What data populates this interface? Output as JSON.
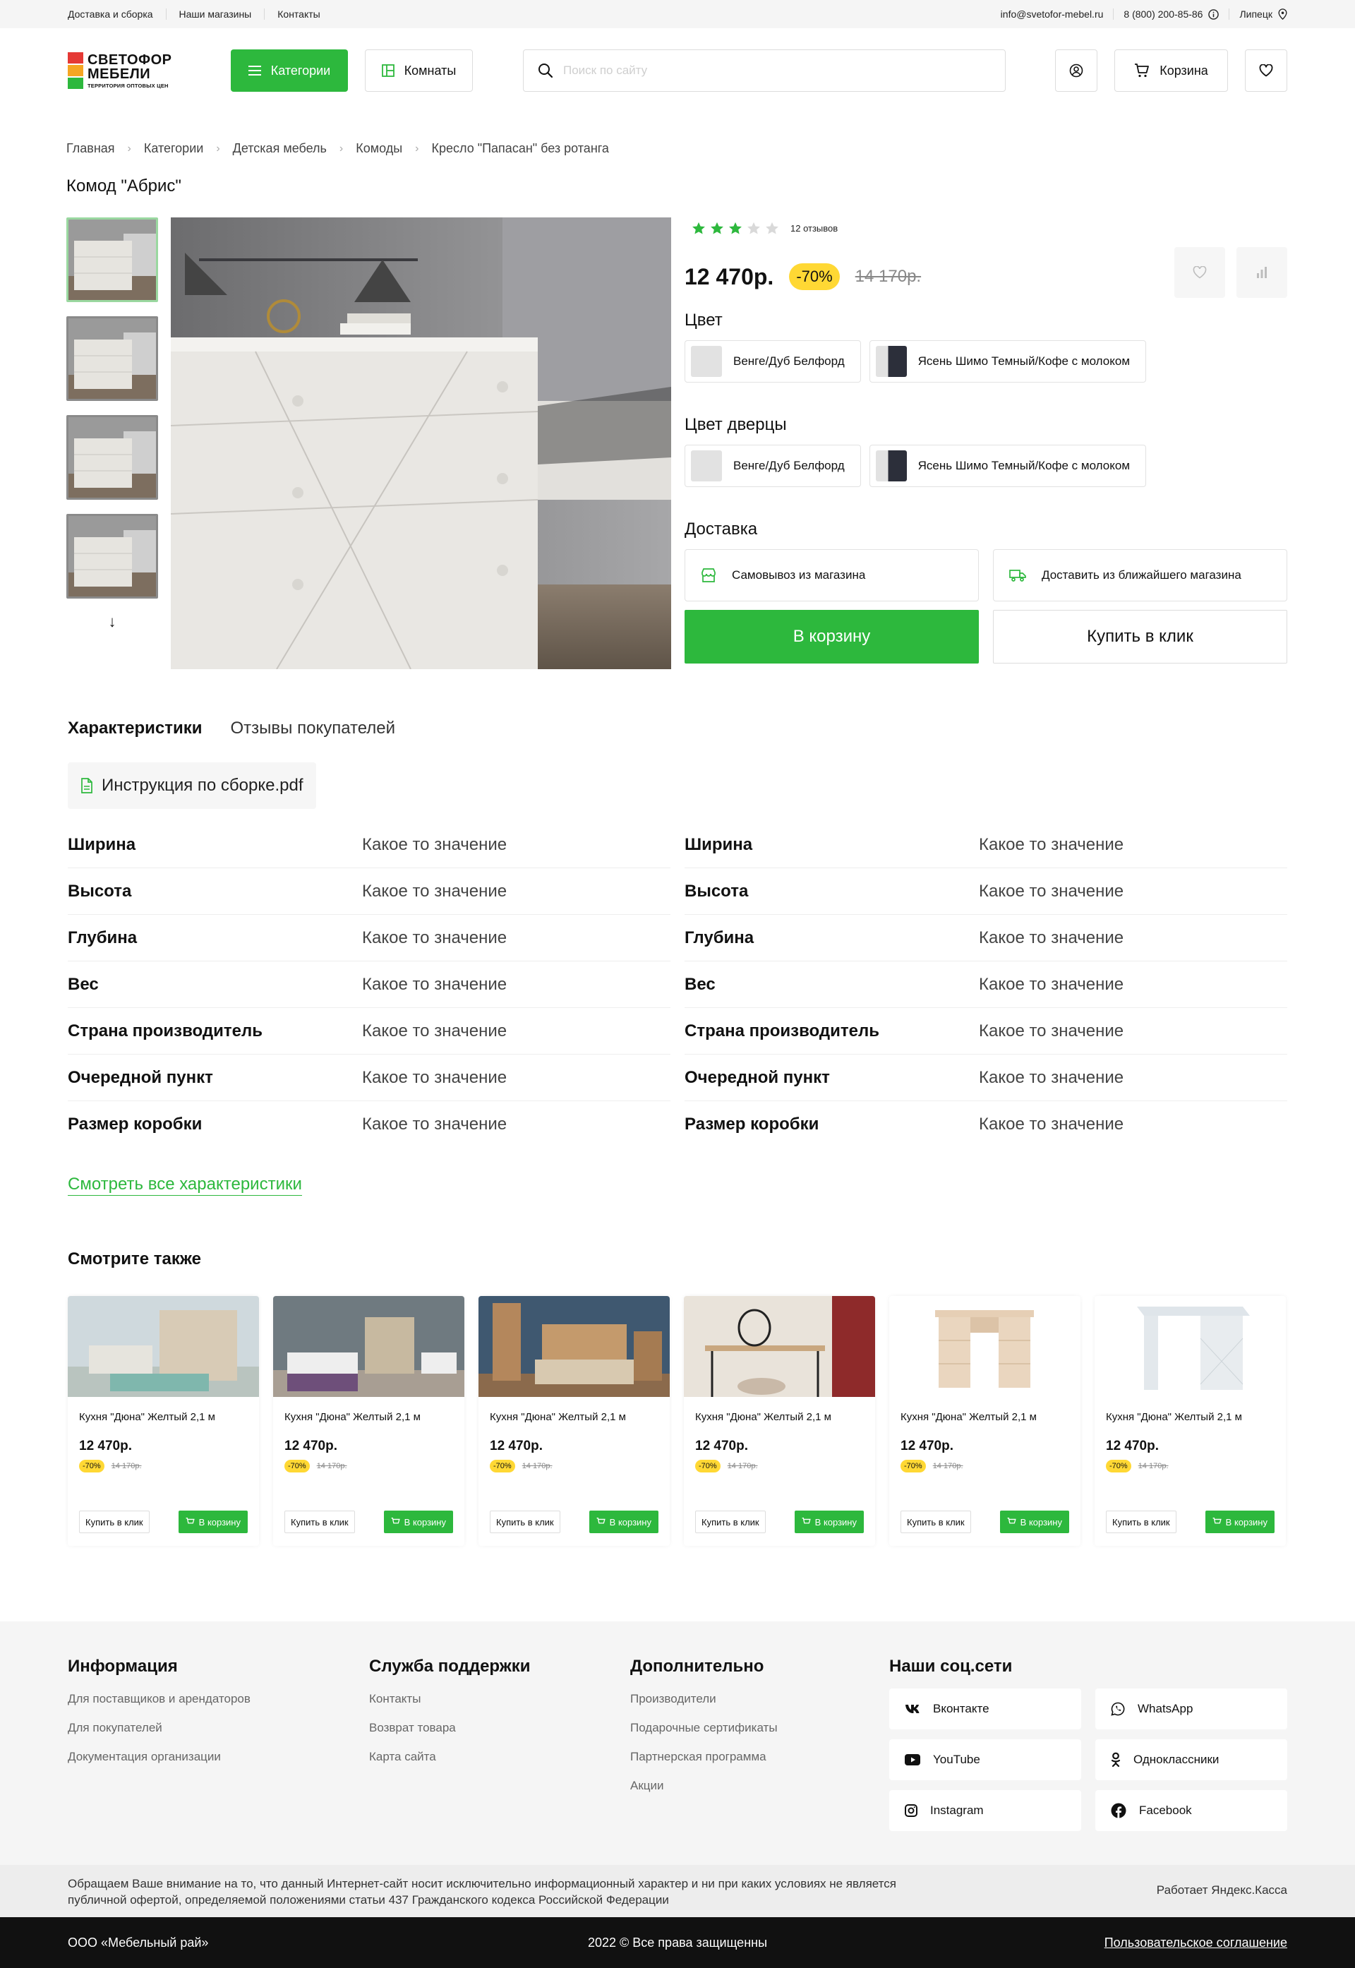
{
  "topbar": {
    "links": [
      "Доставка и сборка",
      "Наши магазины",
      "Контакты"
    ],
    "email": "info@svetofor-mebel.ru",
    "phone": "8 (800) 200-85-86",
    "city": "Липецк"
  },
  "header": {
    "logo_line1": "СВЕТОФОР",
    "logo_line2": "МЕБЕЛИ",
    "logo_tagline": "ТЕРРИТОРИЯ ОПТОВЫХ ЦЕН",
    "categories_label": "Категории",
    "rooms_label": "Комнаты",
    "search_placeholder": "Поиск по сайту",
    "cart_label": "Корзина"
  },
  "breadcrumb": [
    "Главная",
    "Категории",
    "Детская мебель",
    "Комоды",
    "Кресло \"Папасан\" без ротанга"
  ],
  "product": {
    "title": "Комод \"Абрис\"",
    "rating": 3,
    "rating_max": 5,
    "reviews": "12 отзывов",
    "price": "12 470р.",
    "discount": "-70%",
    "old_price": "14 170р.",
    "color_label": "Цвет",
    "colors": [
      {
        "name": "Венге/Дуб Белфорд",
        "swatch": "#e2e2e2"
      },
      {
        "name": "Ясень Шимо Темный/Кофе с молоком",
        "swatch": "#2c2f3a"
      }
    ],
    "door_color_label": "Цвет дверцы",
    "door_colors": [
      {
        "name": "Венге/Дуб Белфорд",
        "swatch": "#e2e2e2"
      },
      {
        "name": "Ясень Шимо Темный/Кофе с молоком",
        "swatch": "#2c2f3a"
      }
    ],
    "delivery_label": "Доставка",
    "delivery_options": [
      "Самовывоз из магазина",
      "Доставить из ближайшего магазина"
    ],
    "add_to_cart": "В корзину",
    "buy_one_click": "Купить в клик"
  },
  "tabs": [
    "Характеристики",
    "Отзывы покупателей"
  ],
  "pdf": "Инструкция по сборке.pdf",
  "specs": {
    "left": [
      {
        "k": "Ширина",
        "v": "Какое то значение"
      },
      {
        "k": "Высота",
        "v": "Какое то значение"
      },
      {
        "k": "Глубина",
        "v": "Какое то значение"
      },
      {
        "k": "Вес",
        "v": "Какое то значение"
      },
      {
        "k": "Страна производитель",
        "v": "Какое то значение"
      },
      {
        "k": "Очередной пункт",
        "v": "Какое то значение"
      },
      {
        "k": "Размер коробки",
        "v": "Какое то значение"
      }
    ],
    "right": [
      {
        "k": "Ширина",
        "v": "Какое то значение"
      },
      {
        "k": "Высота",
        "v": "Какое то значение"
      },
      {
        "k": "Глубина",
        "v": "Какое то значение"
      },
      {
        "k": "Вес",
        "v": "Какое то значение"
      },
      {
        "k": "Страна производитель",
        "v": "Какое то значение"
      },
      {
        "k": "Очередной пункт",
        "v": "Какое то значение"
      },
      {
        "k": "Размер коробки",
        "v": "Какое то значение"
      }
    ]
  },
  "see_all": "Смотреть все характеристики",
  "see_also": {
    "title": "Смотрите также",
    "cards": [
      {
        "name": "Кухня \"Дюна\" Желтый 2,1 м",
        "price": "12 470р.",
        "discount": "-70%",
        "old": "14 170р.",
        "buy": "Купить в клик",
        "cart": "В корзину"
      },
      {
        "name": "Кухня \"Дюна\" Желтый 2,1 м",
        "price": "12 470р.",
        "discount": "-70%",
        "old": "14 170р.",
        "buy": "Купить в клик",
        "cart": "В корзину"
      },
      {
        "name": "Кухня \"Дюна\" Желтый 2,1 м",
        "price": "12 470р.",
        "discount": "-70%",
        "old": "14 170р.",
        "buy": "Купить в клик",
        "cart": "В корзину"
      },
      {
        "name": "Кухня \"Дюна\" Желтый 2,1 м",
        "price": "12 470р.",
        "discount": "-70%",
        "old": "14 170р.",
        "buy": "Купить в клик",
        "cart": "В корзину"
      },
      {
        "name": "Кухня \"Дюна\" Желтый 2,1 м",
        "price": "12 470р.",
        "discount": "-70%",
        "old": "14 170р.",
        "buy": "Купить в клик",
        "cart": "В корзину"
      },
      {
        "name": "Кухня \"Дюна\" Желтый 2,1 м",
        "price": "12 470р.",
        "discount": "-70%",
        "old": "14 170р.",
        "buy": "Купить в клик",
        "cart": "В корзину"
      }
    ]
  },
  "footer": {
    "info": {
      "title": "Информация",
      "links": [
        "Для поставщиков и арендаторов",
        "Для покупателей",
        "Документация организации"
      ]
    },
    "support": {
      "title": "Служба поддержки",
      "links": [
        "Контакты",
        "Возврат товара",
        "Карта сайта"
      ]
    },
    "extra": {
      "title": "Дополнительно",
      "links": [
        "Производители",
        "Подарочные сертификаты",
        "Партнерская программа",
        "Акции"
      ]
    },
    "social": {
      "title": "Наши соц.сети",
      "items": [
        "Вконтакте",
        "WhatsApp",
        "YouTube",
        "Одноклассники",
        "Instagram",
        "Facebook"
      ]
    },
    "notice": "Обращаем Ваше внимание на то, что данный Интернет-сайт носит исключительно информационный характер и ни при каких условиях не является публичной офертой, определяемой положениями статьи 437 Гражданского кодекса Российской Федерации",
    "payment": "Работает Яндекс.Касса",
    "company": "ООО «Мебельный рай»",
    "copyright": "2022 © Все права защищенны",
    "agreement": "Пользовательское соглашение"
  },
  "colors": {
    "accent": "#2db83d",
    "badge": "#ffd834"
  }
}
